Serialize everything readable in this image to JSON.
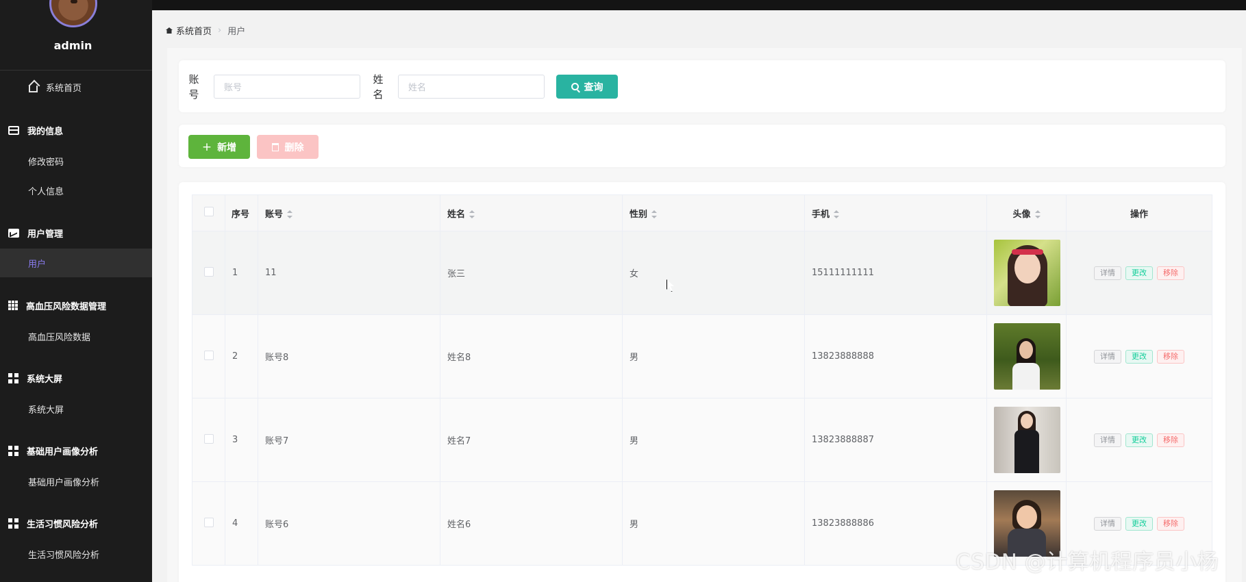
{
  "app": {
    "username": "admin"
  },
  "sidebar": {
    "items": [
      {
        "label": "系统首页",
        "icon": "home-icon",
        "type": "item"
      },
      {
        "label": "我的信息",
        "icon": "card-icon",
        "type": "group"
      },
      {
        "label": "修改密码",
        "type": "sub"
      },
      {
        "label": "个人信息",
        "type": "sub"
      },
      {
        "label": "用户管理",
        "icon": "chart-icon",
        "type": "group"
      },
      {
        "label": "用户",
        "type": "sub",
        "active": true
      },
      {
        "label": "高血压风险数据管理",
        "icon": "table-icon",
        "type": "group"
      },
      {
        "label": "高血压风险数据",
        "type": "sub"
      },
      {
        "label": "系统大屏",
        "icon": "grid-icon",
        "type": "group"
      },
      {
        "label": "系统大屏",
        "type": "sub"
      },
      {
        "label": "基础用户画像分析",
        "icon": "grid-icon",
        "type": "group"
      },
      {
        "label": "基础用户画像分析",
        "type": "sub"
      },
      {
        "label": "生活习惯风险分析",
        "icon": "grid-icon",
        "type": "group"
      },
      {
        "label": "生活习惯风险分析",
        "type": "sub"
      }
    ],
    "active_color": "#8a7cf0"
  },
  "breadcrumb": {
    "home": "系统首页",
    "current": "用户"
  },
  "search": {
    "account_label": "账号",
    "account_label_line1": "账",
    "account_label_line2": "号",
    "account_placeholder": "账号",
    "name_label_line1": "姓",
    "name_label_line2": "名",
    "name_placeholder": "姓名",
    "query_button": "查询"
  },
  "actions": {
    "add_button": "新增",
    "delete_button": "删除"
  },
  "table": {
    "columns": [
      "序号",
      "账号",
      "姓名",
      "性别",
      "手机",
      "头像",
      "操作"
    ],
    "rows": [
      {
        "index": "1",
        "account": "11",
        "name": "张三",
        "gender": "女",
        "phone": "15111111111"
      },
      {
        "index": "2",
        "account": "账号8",
        "name": "姓名8",
        "gender": "男",
        "phone": "13823888888"
      },
      {
        "index": "3",
        "account": "账号7",
        "name": "姓名7",
        "gender": "男",
        "phone": "13823888887"
      },
      {
        "index": "4",
        "account": "账号6",
        "name": "姓名6",
        "gender": "男",
        "phone": "13823888886"
      }
    ],
    "row_actions": {
      "detail": "详情",
      "edit": "更改",
      "remove": "移除"
    }
  },
  "colors": {
    "primary": "#29b3a1",
    "success": "#5eb43c",
    "danger_light": "#fbc4c4",
    "sidebar_bg": "#1c1c1c"
  },
  "watermark": "CSDN @计算机程序员小杨"
}
